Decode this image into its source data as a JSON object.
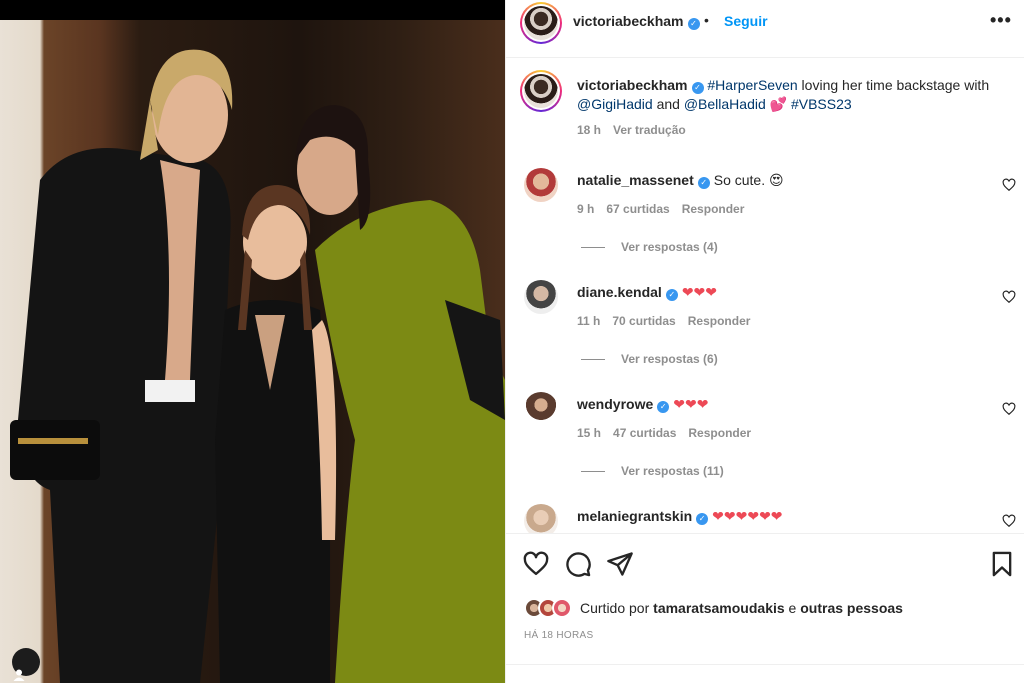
{
  "post": {
    "username": "victoriabeckham",
    "separator": "•",
    "follow_label": "Seguir",
    "more_label": "•••",
    "verified_mark": "✓"
  },
  "caption": {
    "username": "victoriabeckham",
    "hashtag1": "#HarperSeven",
    "text1": " loving her time backstage with ",
    "mention1": "@GigiHadid",
    "text2": " and ",
    "mention2": "@BellaHadid",
    "emoji": " 💕 ",
    "hashtag2": "#VBSS23",
    "time": "18 h",
    "translate_label": "Ver tradução"
  },
  "comments": [
    {
      "username": "natalie_massenet",
      "text": "So cute. 😍",
      "time": "9 h",
      "likes": "67 curtidas",
      "reply_label": "Responder",
      "replies": "Ver respostas (4)",
      "avatar_color": "#b23a3a"
    },
    {
      "username": "diane.kendal",
      "text": "❤❤❤",
      "time": "11 h",
      "likes": "70 curtidas",
      "reply_label": "Responder",
      "replies": "Ver respostas (6)",
      "avatar_color": "#444444"
    },
    {
      "username": "wendyrowe",
      "text": "❤❤❤",
      "time": "15 h",
      "likes": "47 curtidas",
      "reply_label": "Responder",
      "replies": "Ver respostas (11)",
      "avatar_color": "#5a3b2e"
    },
    {
      "username": "melaniegrantskin",
      "text": "❤❤❤❤❤❤",
      "avatar_color": "#c9a98d"
    }
  ],
  "likes_summary": {
    "prefix": "Curtido por ",
    "user": "tamaratsamoudakis",
    "middle": " e ",
    "others": "outras pessoas",
    "time": "HÁ 18 HORAS"
  },
  "colors": {
    "accent": "#0095f6",
    "verified": "#3897f0",
    "heart": "#ed4956",
    "muted": "#8e8e8e",
    "link": "#00376b"
  },
  "icons": {
    "like": "heart-icon",
    "comment": "comment-icon",
    "share": "paper-plane-icon",
    "save": "bookmark-icon",
    "tag": "user-tag-icon",
    "more": "more-options-icon"
  }
}
